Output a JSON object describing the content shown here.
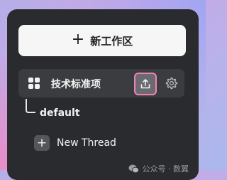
{
  "new_workspace": {
    "icon": "plus-icon",
    "label": "新工作区"
  },
  "workspace": {
    "icon": "grid-icon",
    "name": "技术标准项",
    "upload_icon": "upload-icon",
    "settings_icon": "gear-icon",
    "highlight_color": "#f07fb8"
  },
  "branch": {
    "label": "default"
  },
  "thread": {
    "icon": "plus-icon",
    "label": "New Thread"
  },
  "watermark": {
    "icon": "wechat-icon",
    "text": "公众号 · 数翼"
  }
}
